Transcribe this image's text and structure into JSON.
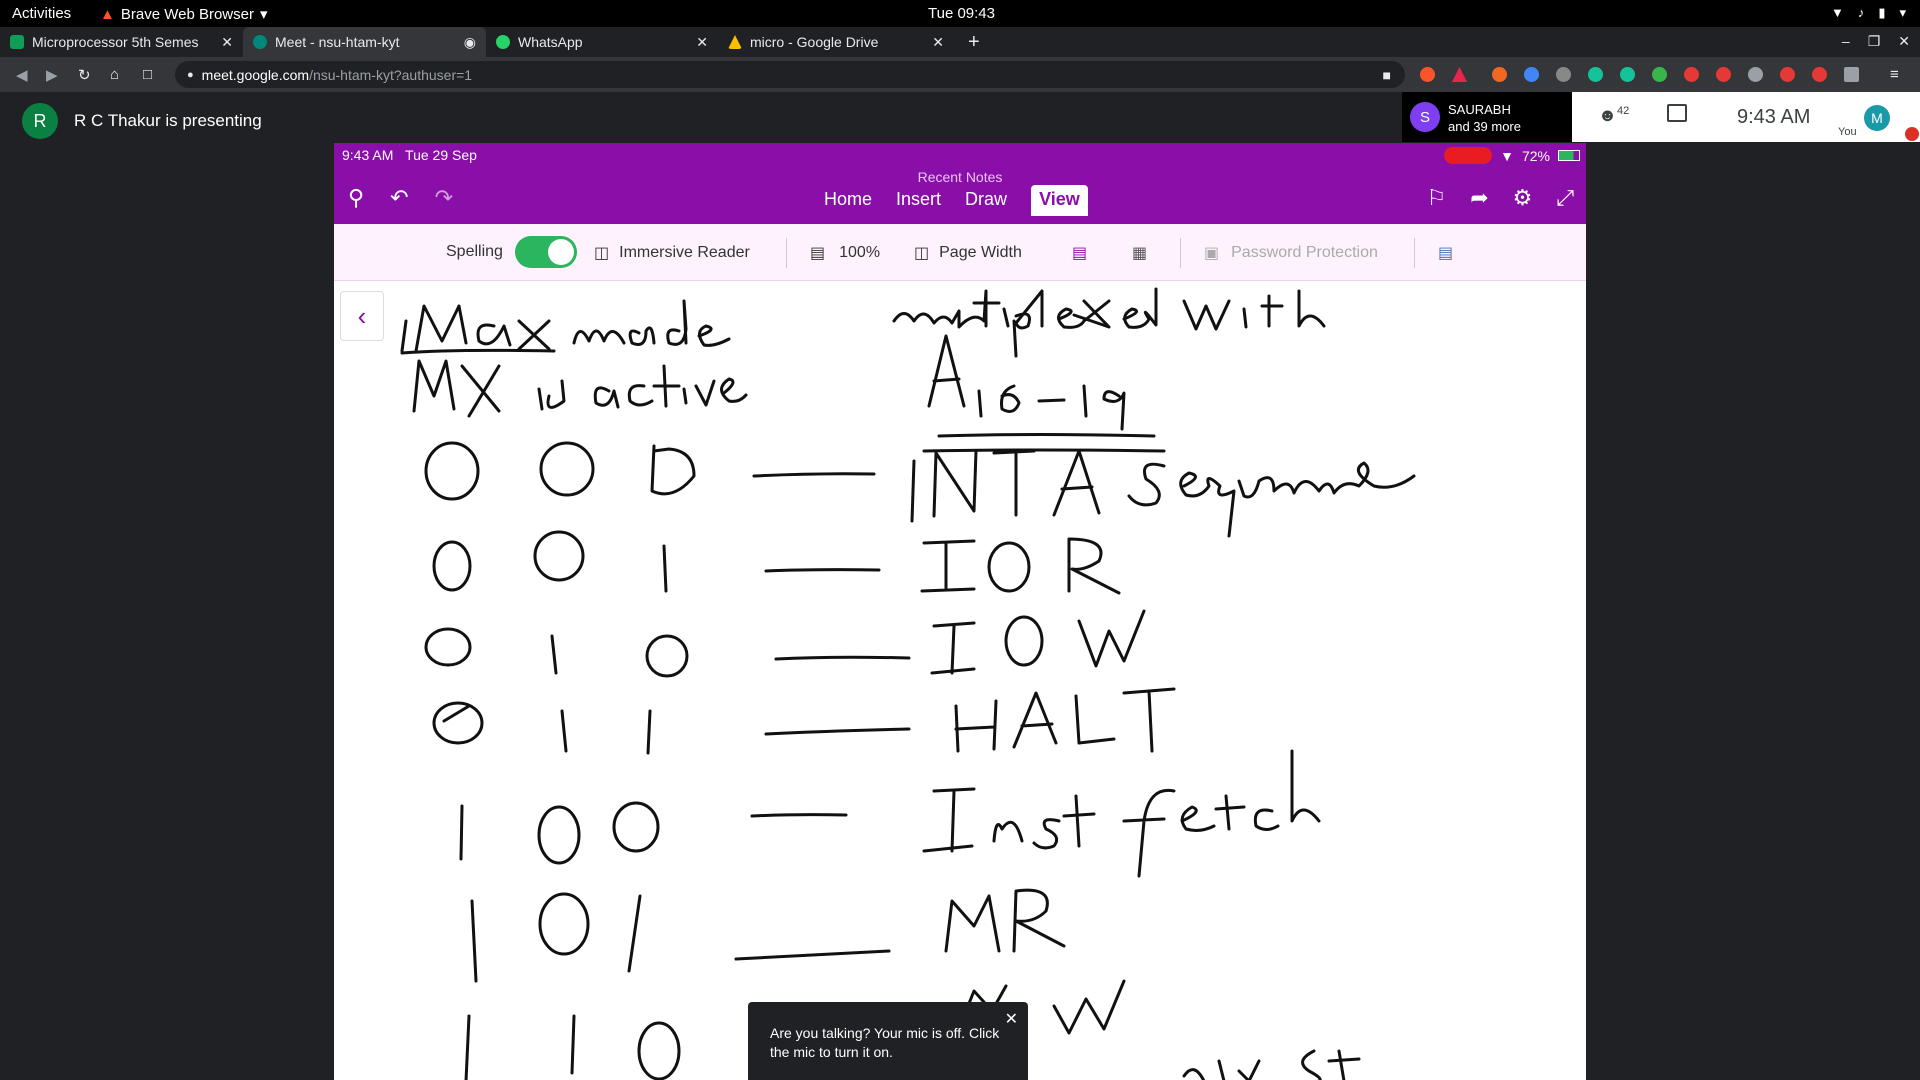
{
  "desktop": {
    "activities": "Activities",
    "app_name": "Brave Web Browser",
    "clock": "Tue 09:43"
  },
  "browser": {
    "tabs": [
      {
        "title": "Microprocessor 5th Semes",
        "color": "#0f9d58",
        "active": false
      },
      {
        "title": "Meet - nsu-htam-kyt",
        "color": "#00897b",
        "active": true
      },
      {
        "title": "WhatsApp",
        "color": "#25d366",
        "active": false
      },
      {
        "title": "micro - Google Drive",
        "color": "#fbbc04",
        "active": false
      }
    ],
    "url_host": "meet.google.com",
    "url_path": "/nsu-htam-kyt?authuser=1"
  },
  "meet": {
    "presenter_initial": "R",
    "presenter_text": "R C Thakur is presenting",
    "participant_initial": "S",
    "participant_name": "SAURABH",
    "participant_more": "and 39 more",
    "people_count": "42",
    "time": "9:43 AM",
    "self_initial": "M",
    "self_label": "You",
    "toast": "Are you talking? Your mic is off. Click the mic to turn it on."
  },
  "ipad": {
    "time": "9:43 AM",
    "date": "Tue 29 Sep",
    "battery": "72%",
    "notebook_title": "Recent Notes",
    "tabs": [
      "Home",
      "Insert",
      "Draw",
      "View"
    ],
    "selected_tab": "View",
    "ribbon": {
      "spelling": "Spelling",
      "immersive": "Immersive Reader",
      "zoom": "100%",
      "page_width": "Page Width",
      "password": "Password Protection"
    }
  }
}
